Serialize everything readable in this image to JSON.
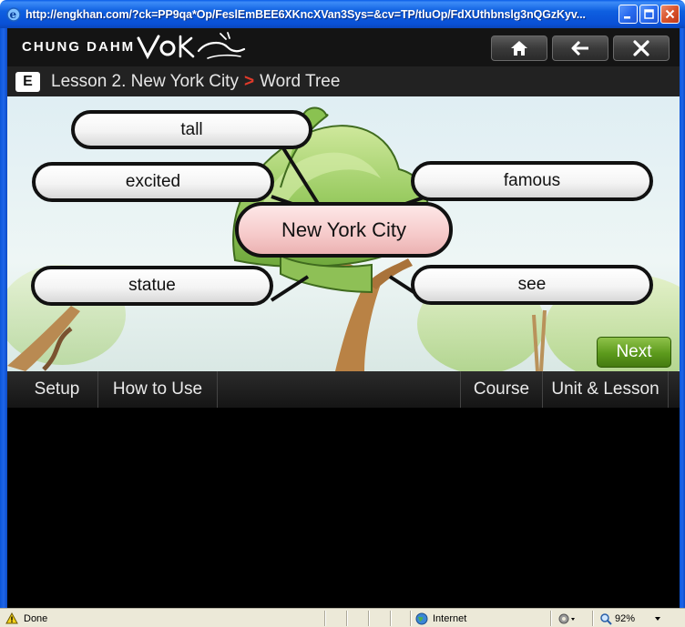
{
  "window": {
    "title": "http://engkhan.com/?ck=PP9qa*Op/FeslEmBEE6XKncXVan3Sys=&cv=TP/tluOp/FdXUthbnslg3nQGzKyv..."
  },
  "header": {
    "brand": "CHUNG DAHM",
    "logo_script": "VoKhan",
    "home_icon": "home-icon",
    "back_icon": "back-arrow-icon",
    "close_icon": "close-icon"
  },
  "breadcrumb": {
    "badge": "E",
    "lesson": "Lesson 2. New York City",
    "separator": ">",
    "page": "Word Tree"
  },
  "word_tree": {
    "center": "New York City",
    "words": [
      "tall",
      "excited",
      "famous",
      "statue",
      "see"
    ]
  },
  "next_label": "Next",
  "nav": {
    "setup": "Setup",
    "how_to_use": "How to Use",
    "course": "Course",
    "unit_lesson": "Unit & Lesson"
  },
  "status": {
    "left": "Done",
    "zone": "Internet",
    "zoom": "92%"
  },
  "colors": {
    "titlebar": "#0950d6",
    "next_green": "#5c9a1c",
    "center_pink": "#f6caca",
    "separator_red": "#e03a2a"
  }
}
